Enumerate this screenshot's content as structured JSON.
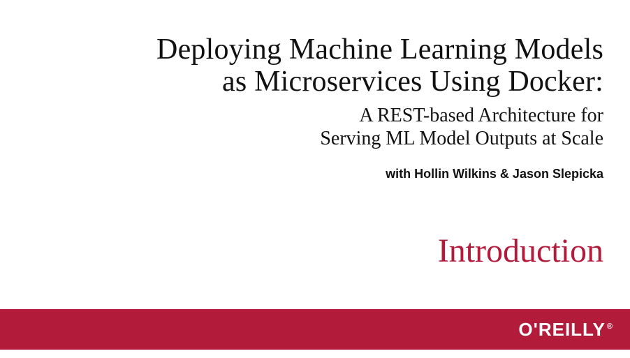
{
  "title_line1": "Deploying Machine Learning Models",
  "title_line2": "as Microservices Using Docker:",
  "subtitle_line1": "A REST-based Architecture for",
  "subtitle_line2": "Serving ML Model Outputs at Scale",
  "authors": "with Hollin Wilkins & Jason Slepicka",
  "section_label": "Introduction",
  "brand": "O'REILLY",
  "brand_mark": "®",
  "colors": {
    "accent": "#b31b3a",
    "text": "#111111",
    "bg": "#ffffff"
  }
}
